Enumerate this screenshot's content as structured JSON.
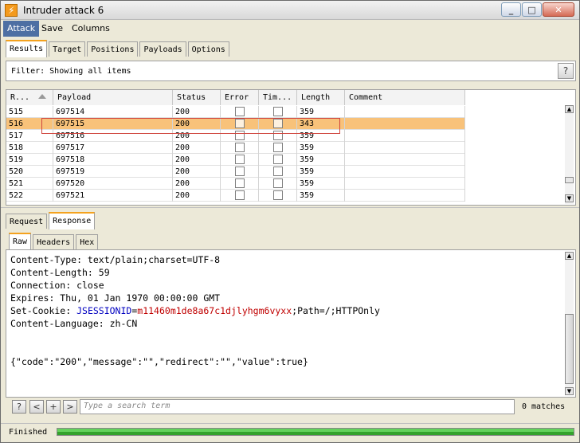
{
  "window": {
    "title": "Intruder attack 6"
  },
  "menu": [
    "Attack",
    "Save",
    "Columns"
  ],
  "main_tabs": [
    "Results",
    "Target",
    "Positions",
    "Payloads",
    "Options"
  ],
  "filter": {
    "text": "Filter: Showing all items",
    "help": "?"
  },
  "table": {
    "columns": [
      "R...",
      "Payload",
      "Status",
      "Error",
      "Tim...",
      "Length",
      "Comment"
    ],
    "rows": [
      {
        "request": "515",
        "payload": "697514",
        "status": "200",
        "length": "359"
      },
      {
        "request": "516",
        "payload": "697515",
        "status": "200",
        "length": "343"
      },
      {
        "request": "517",
        "payload": "697516",
        "status": "200",
        "length": "359"
      },
      {
        "request": "518",
        "payload": "697517",
        "status": "200",
        "length": "359"
      },
      {
        "request": "519",
        "payload": "697518",
        "status": "200",
        "length": "359"
      },
      {
        "request": "520",
        "payload": "697519",
        "status": "200",
        "length": "359"
      },
      {
        "request": "521",
        "payload": "697520",
        "status": "200",
        "length": "359"
      },
      {
        "request": "522",
        "payload": "697521",
        "status": "200",
        "length": "359"
      }
    ],
    "selected_request": "516"
  },
  "detail_tabs": [
    "Request",
    "Response"
  ],
  "view_tabs": [
    "Raw",
    "Headers",
    "Hex"
  ],
  "response": {
    "content_type": "Content-Type: text/plain;charset=UTF-8",
    "content_length": "Content-Length: 59",
    "connection": "Connection: close",
    "expires": "Expires: Thu, 01 Jan 1970 00:00:00 GMT",
    "cookie_prefix": "Set-Cookie: ",
    "cookie_name": "JSESSIONID",
    "cookie_eq": "=",
    "cookie_value": "m11460m1de8a67c1djlyhgm6vyxx",
    "cookie_suffix": ";Path=/;HTTPOnly",
    "content_language": "Content-Language: zh-CN",
    "body": "{\"code\":\"200\",\"message\":\"\",\"redirect\":\"\",\"value\":true}"
  },
  "search": {
    "placeholder": "Type a search term",
    "matches": "0 matches",
    "buttons": [
      "?",
      "<",
      "+",
      ">"
    ]
  },
  "status": {
    "text": "Finished",
    "progress_fraction": 1.0
  }
}
